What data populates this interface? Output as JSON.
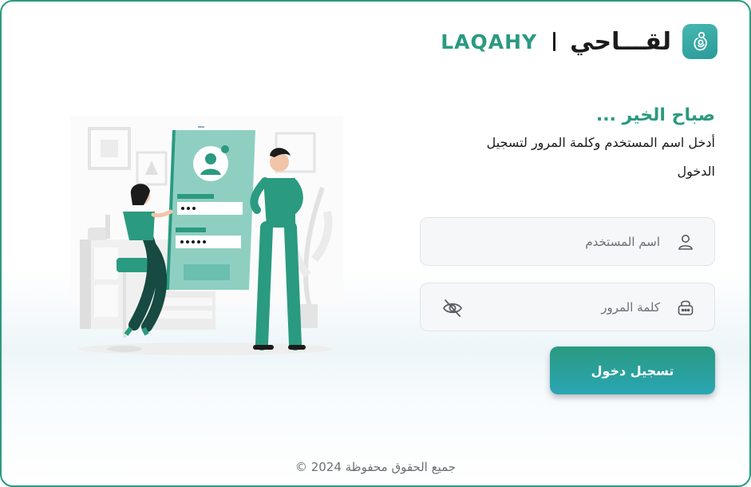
{
  "brand": {
    "name_latin": "LAQAHY",
    "name_arabic": "لقـــاحي",
    "logo_icon": "mother-child-logo-icon",
    "primary_color": "#2a9a80"
  },
  "login": {
    "greeting": "صباح الخير ...",
    "instruction": "أدخل اسم المستخدم وكلمة المرور لتسجيل الدخول",
    "username": {
      "placeholder": "اسم المستخدم",
      "value": "",
      "icon": "user-icon"
    },
    "password": {
      "placeholder": "كلمة المرور",
      "value": "",
      "icon": "lock-icon",
      "toggle_icon": "eye-off-icon"
    },
    "submit_label": "تسجيل دخول"
  },
  "footer": {
    "copyright": "جميع الحقوق محفوظة 2024 ©"
  }
}
